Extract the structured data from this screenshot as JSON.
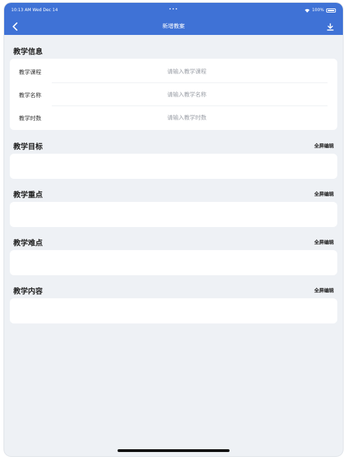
{
  "status_bar": {
    "time": "10:13 AM   Wed Dec 14",
    "dots": "•••",
    "battery": "100%"
  },
  "nav": {
    "title": "新增教案",
    "back_icon": "chevron-left-icon",
    "download_icon": "download-icon"
  },
  "teaching_info": {
    "title": "教学信息",
    "rows": [
      {
        "label": "教学课程",
        "placeholder": "请输入教学课程",
        "value": ""
      },
      {
        "label": "教学名称",
        "placeholder": "请输入教学名称",
        "value": ""
      },
      {
        "label": "教学时数",
        "placeholder": "请输入教学时数",
        "value": ""
      }
    ]
  },
  "sections": [
    {
      "title": "教学目标",
      "action": "全屏编辑"
    },
    {
      "title": "教学重点",
      "action": "全屏编辑"
    },
    {
      "title": "教学难点",
      "action": "全屏编辑"
    },
    {
      "title": "教学内容",
      "action": "全屏编辑"
    }
  ],
  "colors": {
    "accent": "#3f72d6",
    "background": "#eef1f5"
  }
}
